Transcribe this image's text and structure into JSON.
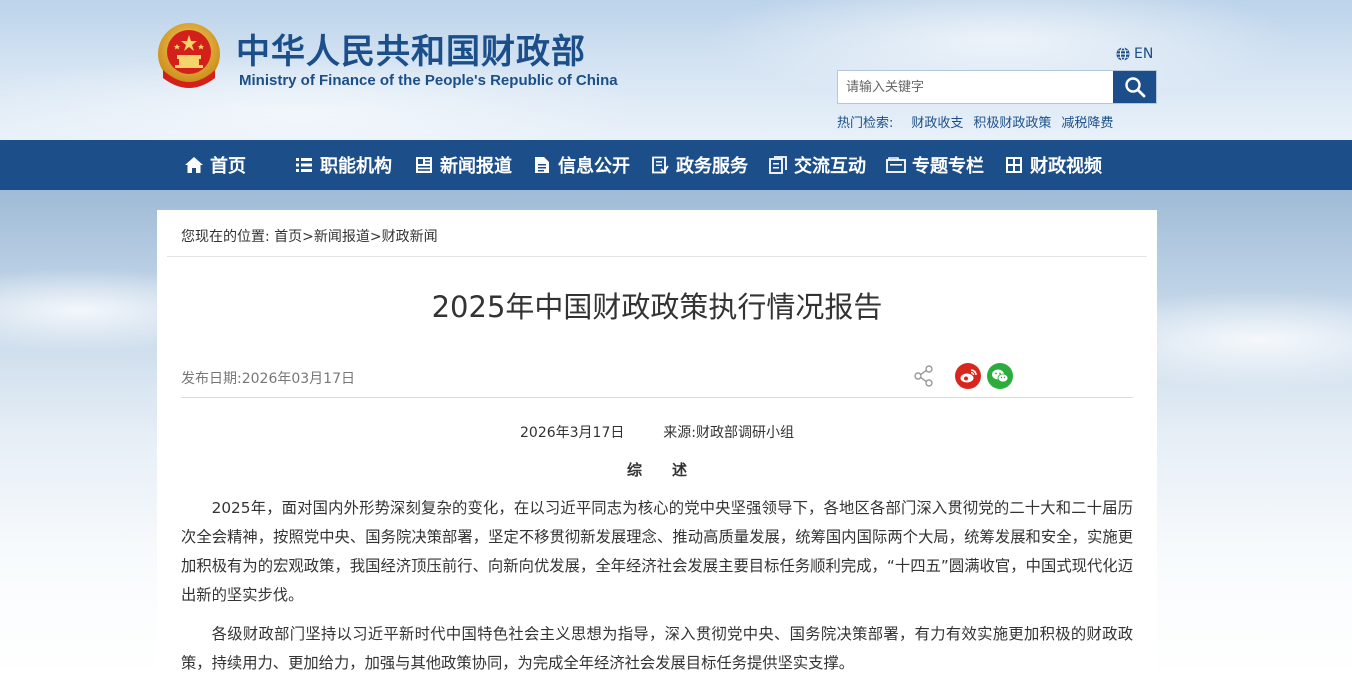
{
  "header": {
    "title_cn": "中华人民共和国财政部",
    "title_en": "Ministry of Finance of the People's Republic of China",
    "lang_label": "EN",
    "search_placeholder": "请输入关键字",
    "hot_label": "热门检索:",
    "hot_links": [
      "财政收支",
      "积极财政政策",
      "减税降费"
    ]
  },
  "nav": {
    "items": [
      {
        "label": "首页",
        "icon": "home-icon"
      },
      {
        "label": "职能机构",
        "icon": "list-icon"
      },
      {
        "label": "新闻报道",
        "icon": "newspaper-icon"
      },
      {
        "label": "信息公开",
        "icon": "document-icon"
      },
      {
        "label": "政务服务",
        "icon": "service-icon"
      },
      {
        "label": "交流互动",
        "icon": "chat-icon"
      },
      {
        "label": "专题专栏",
        "icon": "folder-icon"
      },
      {
        "label": "财政视频",
        "icon": "video-icon"
      }
    ]
  },
  "breadcrumb": {
    "prefix": "您现在的位置:",
    "items": [
      "首页",
      "新闻报道",
      "财政新闻"
    ],
    "separator": ">"
  },
  "article": {
    "title": "2025年中国财政政策执行情况报告",
    "pub_date": "发布日期:2026年03月17日",
    "date_line": "2026年3月17日",
    "source": "来源:财政部调研小组",
    "section_heading": "综述",
    "paragraphs": [
      "2025年，面对国内外形势深刻复杂的变化，在以习近平同志为核心的党中央坚强领导下，各地区各部门深入贯彻党的二十大和二十届历次全会精神，按照党中央、国务院决策部署，坚定不移贯彻新发展理念、推动高质量发展，统筹国内国际两个大局，统筹发展和安全，实施更加积极有为的宏观政策，我国经济顶压前行、向新向优发展，全年经济社会发展主要目标任务顺利完成，“十四五”圆满收官，中国式现代化迈出新的坚实步伐。",
      "各级财政部门坚持以习近平新时代中国特色社会主义思想为指导，深入贯彻党中央、国务院决策部署，有力有效实施更加积极的财政政策，持续用力、更加给力，加强与其他政策协同，为完成全年经济社会发展目标任务提供坚实支撑。"
    ]
  },
  "share": {
    "icons": [
      "share-icon",
      "weibo-icon",
      "wechat-icon"
    ]
  },
  "colors": {
    "brand_blue": "#1c4f8a",
    "weibo_red": "#d9261c",
    "wechat_green": "#2bad3b"
  }
}
